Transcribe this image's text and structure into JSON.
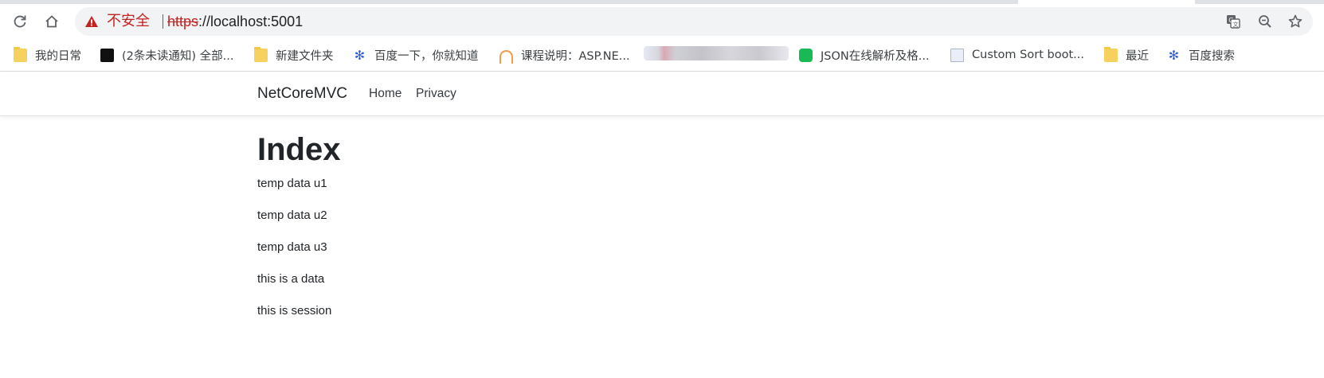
{
  "browser": {
    "security_label": "不安全",
    "url_scheme": "https",
    "url_rest": "://localhost:5001",
    "icons": {
      "reload": "reload-icon",
      "home": "home-icon",
      "warning": "warning-triangle-icon",
      "translate": "translate-icon",
      "zoom": "zoom-out-icon",
      "bookmark": "star-icon"
    },
    "warning_color": "#c5221f"
  },
  "bookmarks": [
    {
      "label": "我的日常",
      "icon": "folder-icon"
    },
    {
      "label": "(2条未读通知) 全部...",
      "icon": "site-icon"
    },
    {
      "label": "新建文件夹",
      "icon": "folder-icon"
    },
    {
      "label": "百度一下，你就知道",
      "icon": "baidu-icon"
    },
    {
      "label": "课程说明：ASP.NE...",
      "icon": "bridge-icon"
    },
    {
      "label": "JSON在线解析及格...",
      "icon": "json-icon"
    },
    {
      "label": "Custom Sort boot...",
      "icon": "document-icon"
    },
    {
      "label": "最近",
      "icon": "folder-icon"
    },
    {
      "label": "百度搜索",
      "icon": "baidu-icon"
    }
  ],
  "site": {
    "brand": "NetCoreMVC",
    "nav": [
      "Home",
      "Privacy"
    ]
  },
  "main": {
    "title": "Index",
    "lines": [
      "temp data u1",
      "temp data u2",
      "temp data u3",
      "this is a data",
      "this is session"
    ]
  }
}
